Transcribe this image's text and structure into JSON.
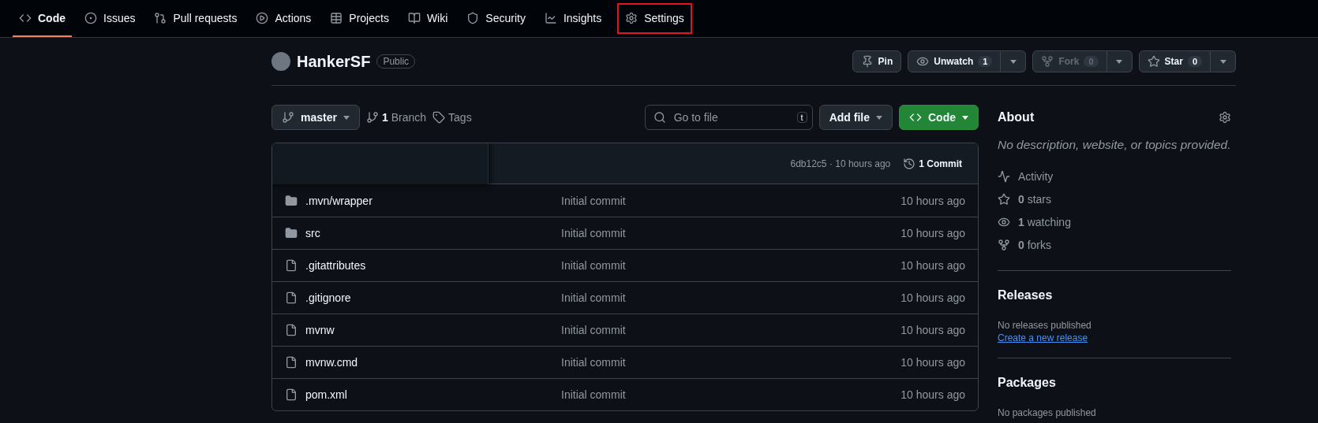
{
  "nav": [
    {
      "label": "Code",
      "selected": true,
      "highlighted": false
    },
    {
      "label": "Issues",
      "selected": false,
      "highlighted": false
    },
    {
      "label": "Pull requests",
      "selected": false,
      "highlighted": false
    },
    {
      "label": "Actions",
      "selected": false,
      "highlighted": false
    },
    {
      "label": "Projects",
      "selected": false,
      "highlighted": false
    },
    {
      "label": "Wiki",
      "selected": false,
      "highlighted": false
    },
    {
      "label": "Security",
      "selected": false,
      "highlighted": false
    },
    {
      "label": "Insights",
      "selected": false,
      "highlighted": false
    },
    {
      "label": "Settings",
      "selected": false,
      "highlighted": true
    }
  ],
  "repo": {
    "name": "HankerSF",
    "visibility": "Public"
  },
  "actions": [
    {
      "label": "Pin",
      "disabled": false
    },
    {
      "label": "Unwatch",
      "count": "1",
      "disabled": false
    },
    {
      "label": "Fork",
      "count": "0",
      "disabled": true
    },
    {
      "label": "Star",
      "count": "0",
      "disabled": false
    }
  ],
  "toolbar": {
    "branch": "master",
    "branches_count": "1",
    "branches_label": "Branch",
    "tags_label": "Tags",
    "search_placeholder": "Go to file",
    "search_key": "t",
    "add_file": "Add file",
    "code": "Code"
  },
  "commit_bar": {
    "hash": "6db12c5",
    "separator": "·",
    "time": "10 hours ago",
    "commits_count": "1",
    "commits_label": "Commit"
  },
  "files": [
    {
      "kind": "folder",
      "name": ".mvn/wrapper",
      "message": "Initial commit",
      "time": "10 hours ago"
    },
    {
      "kind": "folder",
      "name": "src",
      "message": "Initial commit",
      "time": "10 hours ago"
    },
    {
      "kind": "file",
      "name": ".gitattributes",
      "message": "Initial commit",
      "time": "10 hours ago"
    },
    {
      "kind": "file",
      "name": ".gitignore",
      "message": "Initial commit",
      "time": "10 hours ago"
    },
    {
      "kind": "file",
      "name": "mvnw",
      "message": "Initial commit",
      "time": "10 hours ago"
    },
    {
      "kind": "file",
      "name": "mvnw.cmd",
      "message": "Initial commit",
      "time": "10 hours ago"
    },
    {
      "kind": "file",
      "name": "pom.xml",
      "message": "Initial commit",
      "time": "10 hours ago"
    }
  ],
  "about": {
    "title": "About",
    "description": "No description, website, or topics provided.",
    "stats": [
      {
        "label": "Activity"
      },
      {
        "count": "0",
        "label": "stars"
      },
      {
        "count": "1",
        "label": "watching"
      },
      {
        "count": "0",
        "label": "forks"
      }
    ]
  },
  "releases": {
    "title": "Releases",
    "note": "No releases published",
    "link": "Create a new release"
  },
  "packages": {
    "title": "Packages",
    "note": "No packages published"
  }
}
